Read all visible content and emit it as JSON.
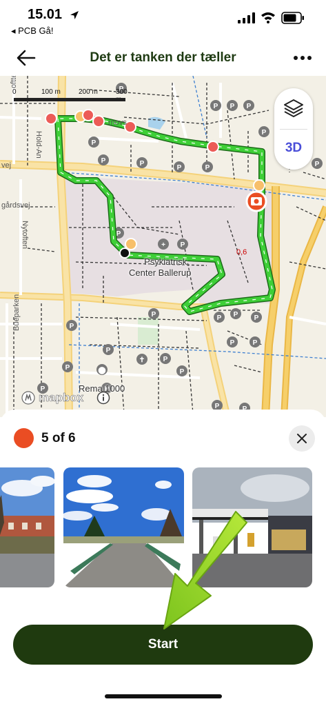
{
  "status_bar": {
    "time": "15.01",
    "back_app": "◂ PCB Gå!"
  },
  "header": {
    "title": "Det er tanken der tæller",
    "back_icon": "arrow-left-icon",
    "more_icon": "more-horizontal-icon"
  },
  "map": {
    "scale_labels": [
      "0",
      "100 m",
      "200 m",
      "300 m"
    ],
    "three_d_label": "3D",
    "layers_icon": "layers-icon",
    "place_label_line1": "Psykiatrisk",
    "place_label_line2": "Center Ballerup",
    "shop_label": "Rema 1000",
    "km_label": "0,6",
    "street_labels": [
      "Hold-An",
      "vej",
      "gårdsvej",
      "Nytoften",
      "Bueparken",
      "oftten",
      "rnovs"
    ],
    "attribution": "mapbox",
    "route_color": "#3ecf37",
    "marker_color": "#ea4d23"
  },
  "sheet": {
    "counter_text": "5 of 6",
    "counter_color": "#ea4d23",
    "close_icon": "close-icon",
    "start_label": "Start",
    "start_color": "#1f3a0f"
  }
}
